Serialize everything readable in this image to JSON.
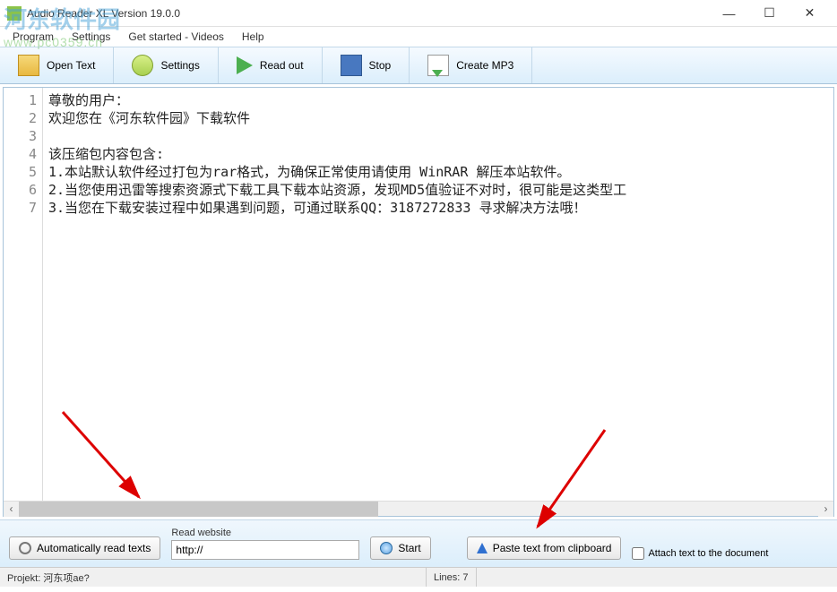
{
  "window": {
    "title": "Audio Reader XL Version 19.0.0"
  },
  "menu": {
    "program": "Program",
    "settings": "Settings",
    "getstarted": "Get started - Videos",
    "help": "Help"
  },
  "toolbar": {
    "open": "Open Text",
    "settings": "Settings",
    "readout": "Read out",
    "stop": "Stop",
    "createmp3": "Create MP3"
  },
  "editor": {
    "lines": [
      "尊敬的用户：",
      "欢迎您在《河东软件园》下载软件",
      "",
      "该压缩包内容包含:",
      "1.本站默认软件经过打包为rar格式，为确保正常使用请使用 WinRAR 解压本站软件。",
      "2.当您使用迅雷等搜索资源式下载工具下载本站资源，发现MD5值验证不对时，很可能是这类型工",
      "3.当您在下载安装过程中如果遇到问题，可通过联系QQ：3187272833 寻求解决方法哦！"
    ]
  },
  "bottom": {
    "auto_read": "Automatically read texts",
    "read_website_label": "Read website",
    "url_value": "http://",
    "start": "Start",
    "paste": "Paste text from clipboard",
    "attach": "Attach text to the document"
  },
  "status": {
    "projekt": "Projekt: 河东项ae?",
    "lines": "Lines:  7"
  },
  "watermark": {
    "text": "河东软件园",
    "url": "www.pc0359.cn"
  }
}
